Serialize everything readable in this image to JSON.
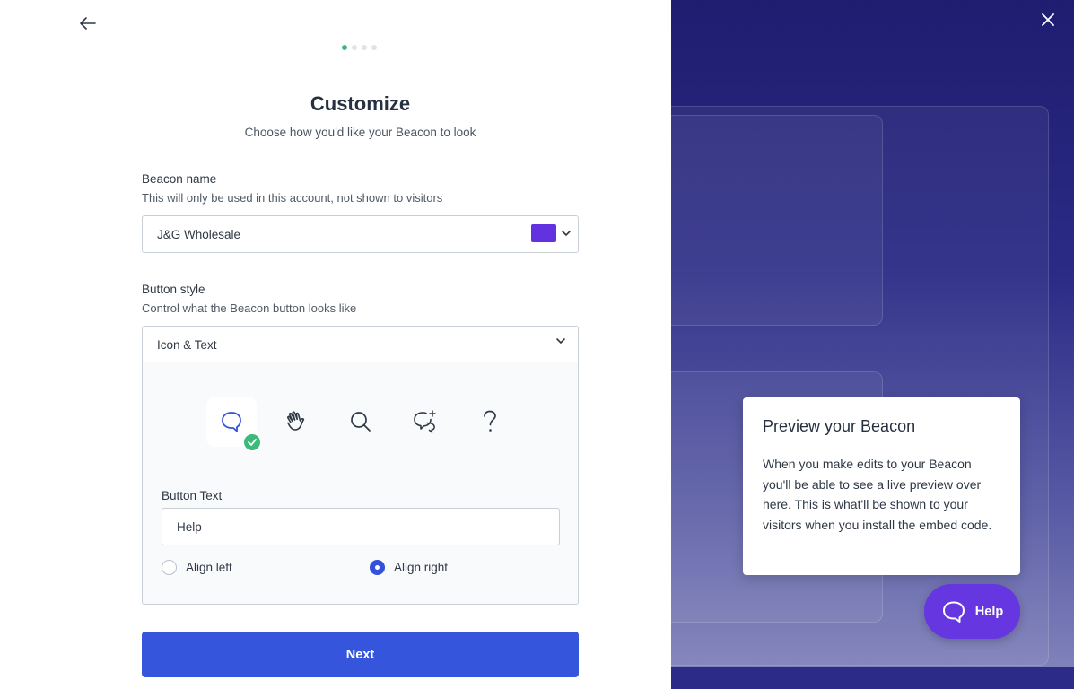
{
  "wizard": {
    "step_index": 1,
    "step_total": 4,
    "title": "Customize",
    "subtitle": "Choose how you'd like your Beacon to look"
  },
  "beacon_name": {
    "label": "Beacon name",
    "help": "This will only be used in this account, not shown to visitors",
    "value": "J&G Wholesale",
    "color": "#6232e0"
  },
  "button_style": {
    "label": "Button style",
    "help": "Control what the Beacon button looks like",
    "selected": "Icon & Text",
    "icons": [
      "chat-bubble-icon",
      "waving-hand-icon",
      "search-icon",
      "chat-sparkle-icon",
      "question-mark-icon"
    ],
    "selected_icon": "chat-bubble-icon"
  },
  "button_text": {
    "label": "Button Text",
    "value": "Help"
  },
  "alignment": {
    "left_label": "Align left",
    "right_label": "Align right",
    "selected": "right"
  },
  "actions": {
    "next_label": "Next"
  },
  "preview": {
    "title": "Preview your Beacon",
    "body": "When you make edits to your Beacon you'll be able to see a live preview over here. This is what'll be shown to your visitors when you install the embed code.",
    "button_label": "Help",
    "button_color": "#6637e0"
  },
  "colors": {
    "primary": "#3556dc",
    "success": "#3cba7a",
    "panel_bg": "#2b2b86"
  }
}
